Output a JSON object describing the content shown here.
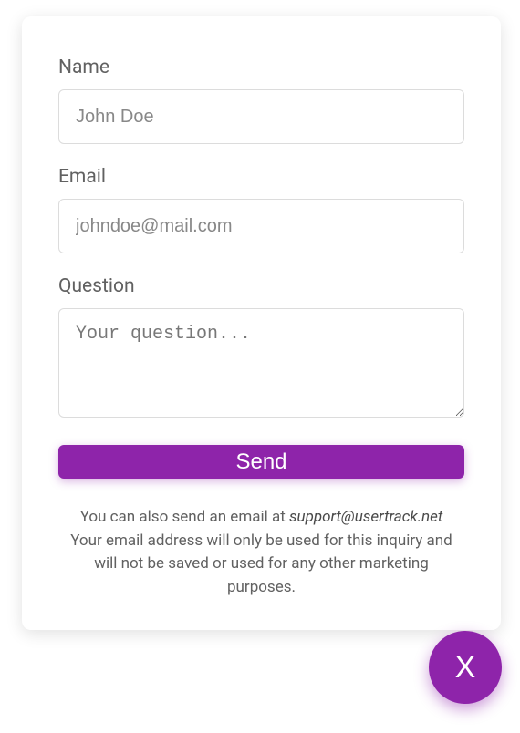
{
  "form": {
    "name": {
      "label": "Name",
      "placeholder": "John Doe",
      "value": ""
    },
    "email": {
      "label": "Email",
      "placeholder": "johndoe@mail.com",
      "value": ""
    },
    "question": {
      "label": "Question",
      "placeholder": "Your question...",
      "value": ""
    },
    "submit_label": "Send"
  },
  "footer": {
    "line1_prefix": "You can also send an email at ",
    "support_email": "support@usertrack.net",
    "line2": "Your email address will only be used for this inquiry and will not be saved or used for any other marketing purposes."
  },
  "fab": {
    "label": "X"
  },
  "colors": {
    "accent": "#8e24aa",
    "text_muted": "#616161",
    "border": "#dcdcdc"
  }
}
